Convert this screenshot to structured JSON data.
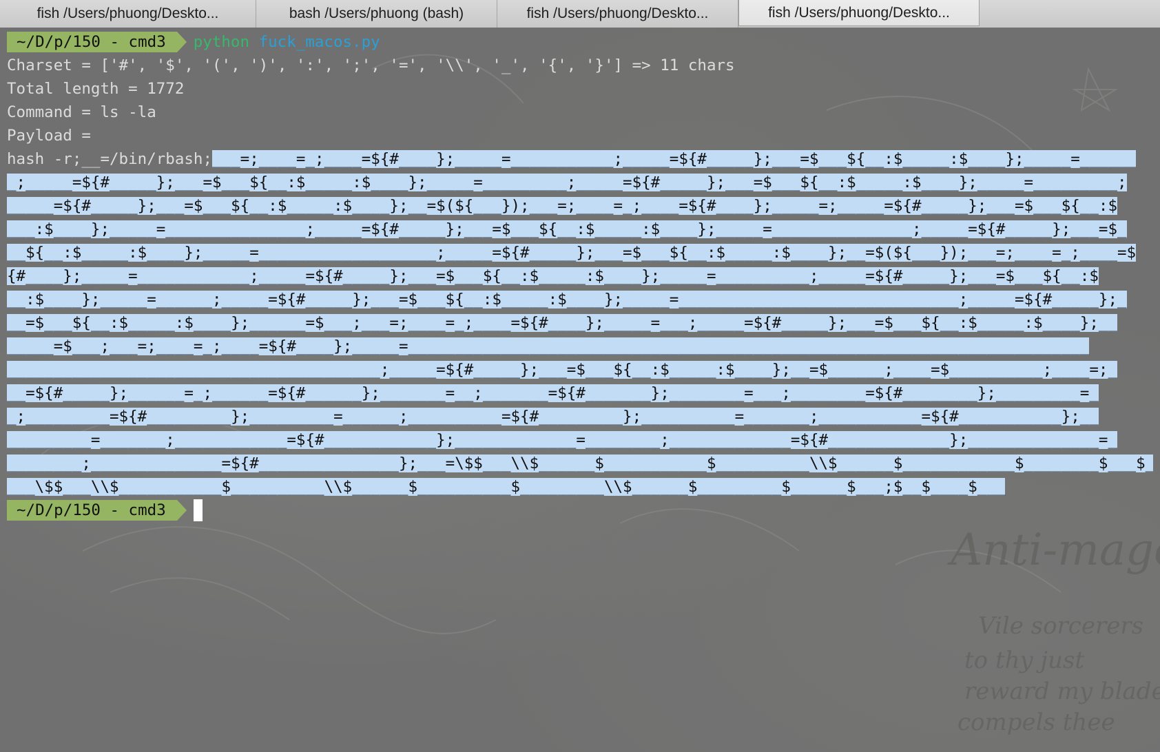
{
  "tabs": [
    {
      "label": "fish  /Users/phuong/Deskto..."
    },
    {
      "label": "bash  /Users/phuong (bash)"
    },
    {
      "label": "fish  /Users/phuong/Deskto..."
    },
    {
      "label": "fish  /Users/phuong/Deskto..."
    }
  ],
  "terminal": {
    "prompt_dir": "~/D/p/150 - cmd3",
    "command": "python",
    "command_arg": "fuck_macos.py",
    "output": [
      "Charset = ['#', '$', '(', ')', ':', ';', '=', '\\\\', '_', '{', '}'] => 11 chars",
      "Total length = 1772",
      "Command = ls -la",
      "Payload ="
    ],
    "payload_prefix": "hash -r;__=/bin/rbash;",
    "payload_lines": [
      "___=;____=_;____=${#____};_____=___________;_____=${#_____};___=$___${__:$_____:$____};_____=______",
      "_;_____=${#_____};___=$___${__:$_____:$____};_____=_________;_____=${#_____};___=$___${__:$_____:$____};_____=_________;",
      "_____=${#_____};___=$___${__:$_____:$____};__=$(${___});___=;____=_;____=${#____};_____=;_____=${#_____};___=$___${__:$",
      "___:$____};_____=_______________;_____=${#_____};___=$___${__:$_____:$____};_____=_______________;_____=${#_____};___=$_",
      "__${__:$_____:$____};_____=___________________;_____=${#_____};___=$___${__:$_____:$____};__=$(${___});___=;____=_;____=$",
      "{#____};_____=____________;_____=${#_____};___=$___${__:$_____:$____};_____=__________;_____=${#_____};___=$___${__:$",
      "__:$____};_____=______;_____=${#_____};___=$___${__:$_____:$____};_____=______________________________;_____=${#_____};_",
      "__=$___${__:$_____:$____};______=$___;___=;____=_;____=${#____};_____=___;_____=${#_____};___=$___${__:$_____:$____};__",
      "_____=$___;___=;____=_;____=${#____};_____=_________________________________________________________________________",
      "________________________________________;_____=${#_____};___=$___${__:$_____:$____};__=$______;____=$__________;____=;_",
      "__=${#_____};______=_;______=${#______};_______=__;_______=${#_______};________=___;________=${#________};_________=_",
      "_;_________=${#_________};_________=______;__________=${#_________};__________=_______;___________=${#___________};__",
      "_________=_______;____________=${#____________};_____________=________;_____________=${#_____________};______________=_",
      "________;______________=${#_______________};___=\\$$___\\\\$______$___________$__________\\\\$______$____________$________$___$_",
      "___\\$$___\\\\$___________$__________\\\\$______$__________$_________\\\\$______$_________$______$___;$__$____$___"
    ],
    "final_prompt_dir": "~/D/p/150 - cmd3"
  },
  "colors": {
    "prompt_badge": "#95b563",
    "command": "#37b86a",
    "command_arg": "#2aa0d6",
    "selection": "#c3dcf6",
    "output_text": "#dcdcdc",
    "tab_bar": "#d0d0d0"
  }
}
